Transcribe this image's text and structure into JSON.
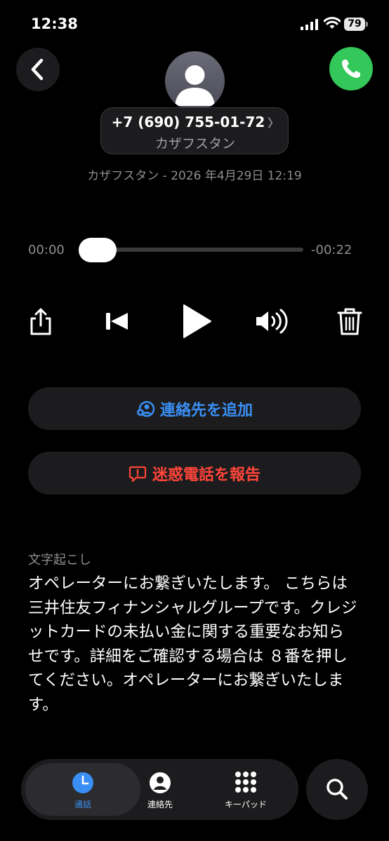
{
  "status": {
    "time": "12:38",
    "battery": "79"
  },
  "header": {
    "phone_number": "+7 (690) 755-01-72",
    "country": "カザフスタン",
    "date_line": "カザフスタン - 2026 年4月29日 12:19"
  },
  "player": {
    "elapsed": "00:00",
    "remaining": "-00:22",
    "progress": 0
  },
  "actions": {
    "add_contact": "連絡先を追加",
    "report_spam": "迷惑電話を報告"
  },
  "transcript": {
    "label": "文字起こし",
    "text": "オペレーターにお繋ぎいたします。 こちらは三井住友フィナンシャルグループです。クレジットカードの未払い金に関する重要なお知らせです。詳細をご確認する場合は ８番を押してください。オペレーターにお繋ぎいたします。"
  },
  "tabs": [
    {
      "label": "通話",
      "icon": "clock-icon",
      "active": true
    },
    {
      "label": "連絡先",
      "icon": "person-icon",
      "active": false
    },
    {
      "label": "キーパッド",
      "icon": "keypad-icon",
      "active": false
    }
  ],
  "colors": {
    "accent": "#3a8ff5",
    "danger": "#ff453a",
    "call": "#34c759"
  }
}
